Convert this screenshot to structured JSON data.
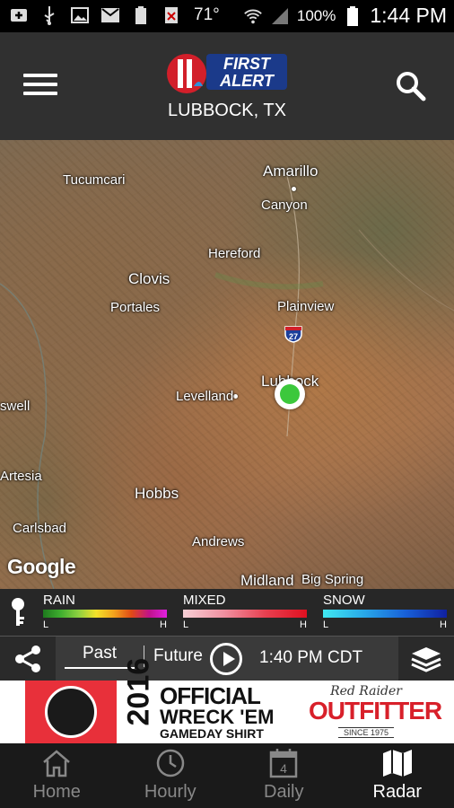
{
  "status_bar": {
    "temperature": "71°",
    "battery_percent": "100%",
    "time": "1:44 PM",
    "icons": [
      "add-box-icon",
      "usb-icon",
      "image-icon",
      "gmail-icon",
      "battery-100-icon",
      "no-sim-icon",
      "wifi-icon",
      "signal-icon",
      "battery-icon"
    ]
  },
  "header": {
    "logo_text_line1": "FIRST",
    "logo_text_line2": "ALERT",
    "location": "LUBBOCK, TX",
    "menu_icon": "hamburger-menu-icon",
    "search_icon": "search-icon"
  },
  "map": {
    "cities": [
      "Amarillo",
      "Tucumcari",
      "Canyon",
      "Hereford",
      "Clovis",
      "Portales",
      "Plainview",
      "Lubbock",
      "Levelland",
      "swell",
      "Artesia",
      "Hobbs",
      "Carlsbad",
      "Andrews",
      "Midland",
      "Big Spring"
    ],
    "highway_shield": "27",
    "attribution": "Google",
    "marker_color": "#3cc83c"
  },
  "legend": {
    "key_icon": "key-icon",
    "rain": {
      "label": "RAIN",
      "low": "L",
      "high": "H"
    },
    "mixed": {
      "label": "MIXED",
      "low": "L",
      "high": "H"
    },
    "snow": {
      "label": "SNOW",
      "low": "L",
      "high": "H"
    }
  },
  "controls": {
    "past_label": "Past",
    "future_label": "Future",
    "time": "1:40 PM CDT",
    "share_icon": "share-icon",
    "play_icon": "play-icon",
    "layers_icon": "layers-icon"
  },
  "ad": {
    "year": "2016",
    "line1": "OFFICIAL",
    "line2": "WRECK 'EM",
    "line3": "GAMEDAY SHIRT",
    "brand_script": "Red Raider",
    "brand_main": "OUTFITTER",
    "brand_since": "SINCE 1975"
  },
  "nav": {
    "items": [
      {
        "label": "Home",
        "icon": "home-icon"
      },
      {
        "label": "Hourly",
        "icon": "clock-icon"
      },
      {
        "label": "Daily",
        "icon": "calendar-icon",
        "icon_number": "4"
      },
      {
        "label": "Radar",
        "icon": "map-icon"
      }
    ],
    "active": "Radar"
  }
}
